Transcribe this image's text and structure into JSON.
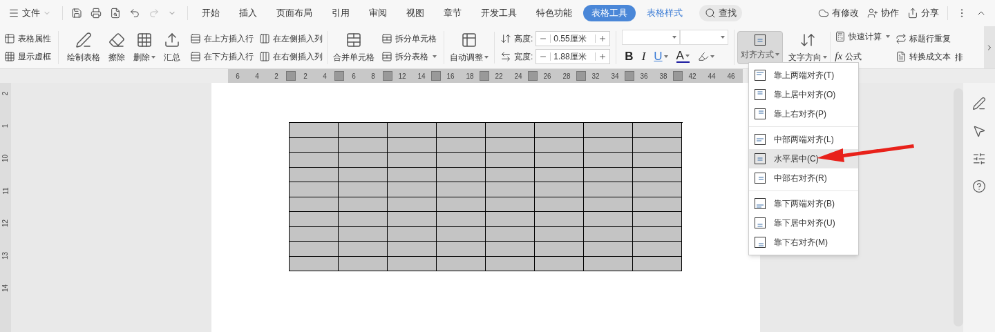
{
  "menu_bar": {
    "file_menu": "文件",
    "tabs": [
      {
        "label": "开始",
        "selected": false,
        "contextual": false
      },
      {
        "label": "插入",
        "selected": false,
        "contextual": false
      },
      {
        "label": "页面布局",
        "selected": false,
        "contextual": false
      },
      {
        "label": "引用",
        "selected": false,
        "contextual": false
      },
      {
        "label": "审阅",
        "selected": false,
        "contextual": false
      },
      {
        "label": "视图",
        "selected": false,
        "contextual": false
      },
      {
        "label": "章节",
        "selected": false,
        "contextual": false
      },
      {
        "label": "开发工具",
        "selected": false,
        "contextual": false
      },
      {
        "label": "特色功能",
        "selected": false,
        "contextual": false
      },
      {
        "label": "表格工具",
        "selected": true,
        "contextual": true
      },
      {
        "label": "表格样式",
        "selected": false,
        "contextual": true
      }
    ],
    "search": "查找",
    "actions": [
      "有修改",
      "协作",
      "分享"
    ]
  },
  "ribbon": {
    "properties": [
      "表格属性",
      "显示虚框"
    ],
    "big_buttons": [
      {
        "label": "绘制表格",
        "dropdown": false
      },
      {
        "label": "擦除",
        "dropdown": false
      },
      {
        "label": "删除",
        "dropdown": true
      },
      {
        "label": "汇总",
        "dropdown": false
      }
    ],
    "insert": [
      "在上方插入行",
      "在下方插入行",
      "在左侧插入列",
      "在右侧插入列"
    ],
    "merge": "合并单元格",
    "split": [
      {
        "label": "拆分单元格",
        "dropdown": false
      },
      {
        "label": "拆分表格",
        "dropdown": true
      }
    ],
    "autofit": "自动调整",
    "height": {
      "label": "高度:",
      "value": "0.55厘米"
    },
    "width": {
      "label": "宽度:",
      "value": "1.88厘米"
    },
    "font_styles": [
      "B",
      "I",
      "U",
      "A"
    ],
    "align": {
      "label": "对齐方式",
      "pressed": true
    },
    "direction": "文字方向",
    "calc": [
      "快速计算",
      "公式"
    ],
    "formula_icon": "fx",
    "header": [
      "标题行重复",
      "转换成文本"
    ],
    "cut": "排"
  },
  "ruler": [
    "6",
    "4",
    "2",
    "2",
    "4",
    "6",
    "8",
    "12",
    "14",
    "16",
    "18",
    "22",
    "24",
    "26",
    "28",
    "32",
    "34",
    "36",
    "38",
    "42",
    "44",
    "46"
  ],
  "vertical_ruler": [
    "2",
    "1",
    "10",
    "11",
    "12",
    "13",
    "14"
  ],
  "align_menu": {
    "groups": [
      [
        {
          "label": "靠上两端对齐(T)",
          "selected": false
        },
        {
          "label": "靠上居中对齐(O)",
          "selected": false
        },
        {
          "label": "靠上右对齐(P)",
          "selected": false
        }
      ],
      [
        {
          "label": "中部两端对齐(L)",
          "selected": false
        },
        {
          "label": "水平居中(C)",
          "selected": true
        },
        {
          "label": "中部右对齐(R)",
          "selected": false
        }
      ],
      [
        {
          "label": "靠下两端对齐(B)",
          "selected": false
        },
        {
          "label": "靠下居中对齐(U)",
          "selected": false
        },
        {
          "label": "靠下右对齐(M)",
          "selected": false
        }
      ]
    ]
  }
}
